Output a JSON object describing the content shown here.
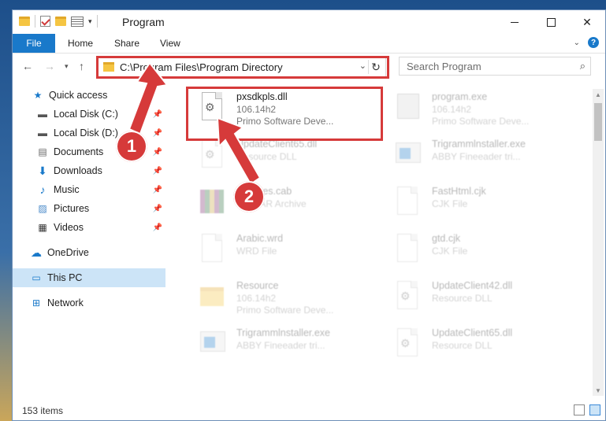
{
  "window": {
    "title": "Program",
    "qat_dropdown": "▾"
  },
  "ribbon": {
    "file": "File",
    "tabs": [
      "Home",
      "Share",
      "View"
    ]
  },
  "address": {
    "path": "C:\\Program Files\\Program Directory",
    "search_placeholder": "Search Program"
  },
  "nav": {
    "items": [
      {
        "label": "Quick access",
        "icon": "star-icon"
      },
      {
        "label": "Local Disk (C:)",
        "icon": "drive-icon",
        "pinned": true
      },
      {
        "label": "Local Disk (D:)",
        "icon": "drive-icon",
        "pinned": true
      },
      {
        "label": "Documents",
        "icon": "documents-icon",
        "pinned": true
      },
      {
        "label": "Downloads",
        "icon": "download-icon",
        "pinned": true
      },
      {
        "label": "Music",
        "icon": "music-icon",
        "pinned": true
      },
      {
        "label": "Pictures",
        "icon": "pictures-icon",
        "pinned": true
      },
      {
        "label": "Videos",
        "icon": "videos-icon",
        "pinned": true
      },
      {
        "label": "OneDrive",
        "icon": "cloud-icon"
      },
      {
        "label": "This PC",
        "icon": "computer-icon",
        "selected": true
      },
      {
        "label": "Network",
        "icon": "network-icon"
      }
    ]
  },
  "files": [
    {
      "name": "pxsdkpls.dll",
      "type": "106.14h2",
      "extra": "Primo Software Deve...",
      "icon": "dll-gear-icon"
    },
    {
      "name": "program.exe",
      "type": "106.14h2",
      "extra": "Primo Software Deve...",
      "icon": "exe-icon"
    },
    {
      "name": "UpdateClient65.dll",
      "type": "Resource DLL",
      "extra": "",
      "icon": "dll-gear-icon"
    },
    {
      "name": "Trigrammlnstaller.exe",
      "type": "ABBY Fineeader tri...",
      "extra": "",
      "icon": "app-window-icon"
    },
    {
      "name": "Updates.cab",
      "type": "WinRAR Archive",
      "extra": "",
      "icon": "archive-icon"
    },
    {
      "name": "FastHtml.cjk",
      "type": "CJK File",
      "extra": "",
      "icon": "blank-file-icon"
    },
    {
      "name": "Arabic.wrd",
      "type": "WRD File",
      "extra": "",
      "icon": "blank-file-icon"
    },
    {
      "name": "gtd.cjk",
      "type": "CJK File",
      "extra": "",
      "icon": "blank-file-icon"
    },
    {
      "name": "Resource",
      "type": "106.14h2",
      "extra": "Primo Software Deve...",
      "icon": "folder-icon"
    },
    {
      "name": "UpdateClient42.dll",
      "type": "Resource DLL",
      "extra": "",
      "icon": "dll-gear-icon"
    },
    {
      "name": "Trigrammlnstaller.exe",
      "type": "ABBY Fineeader tri...",
      "extra": "",
      "icon": "app-window-icon"
    },
    {
      "name": "UpdateClient65.dll",
      "type": "Resource DLL",
      "extra": "",
      "icon": "dll-gear-icon"
    }
  ],
  "status": {
    "items": "153 items"
  },
  "callouts": [
    "1",
    "2"
  ],
  "colors": {
    "accent": "#1979ca",
    "highlight_red": "#d63a3a",
    "selected": "#cce4f7"
  }
}
